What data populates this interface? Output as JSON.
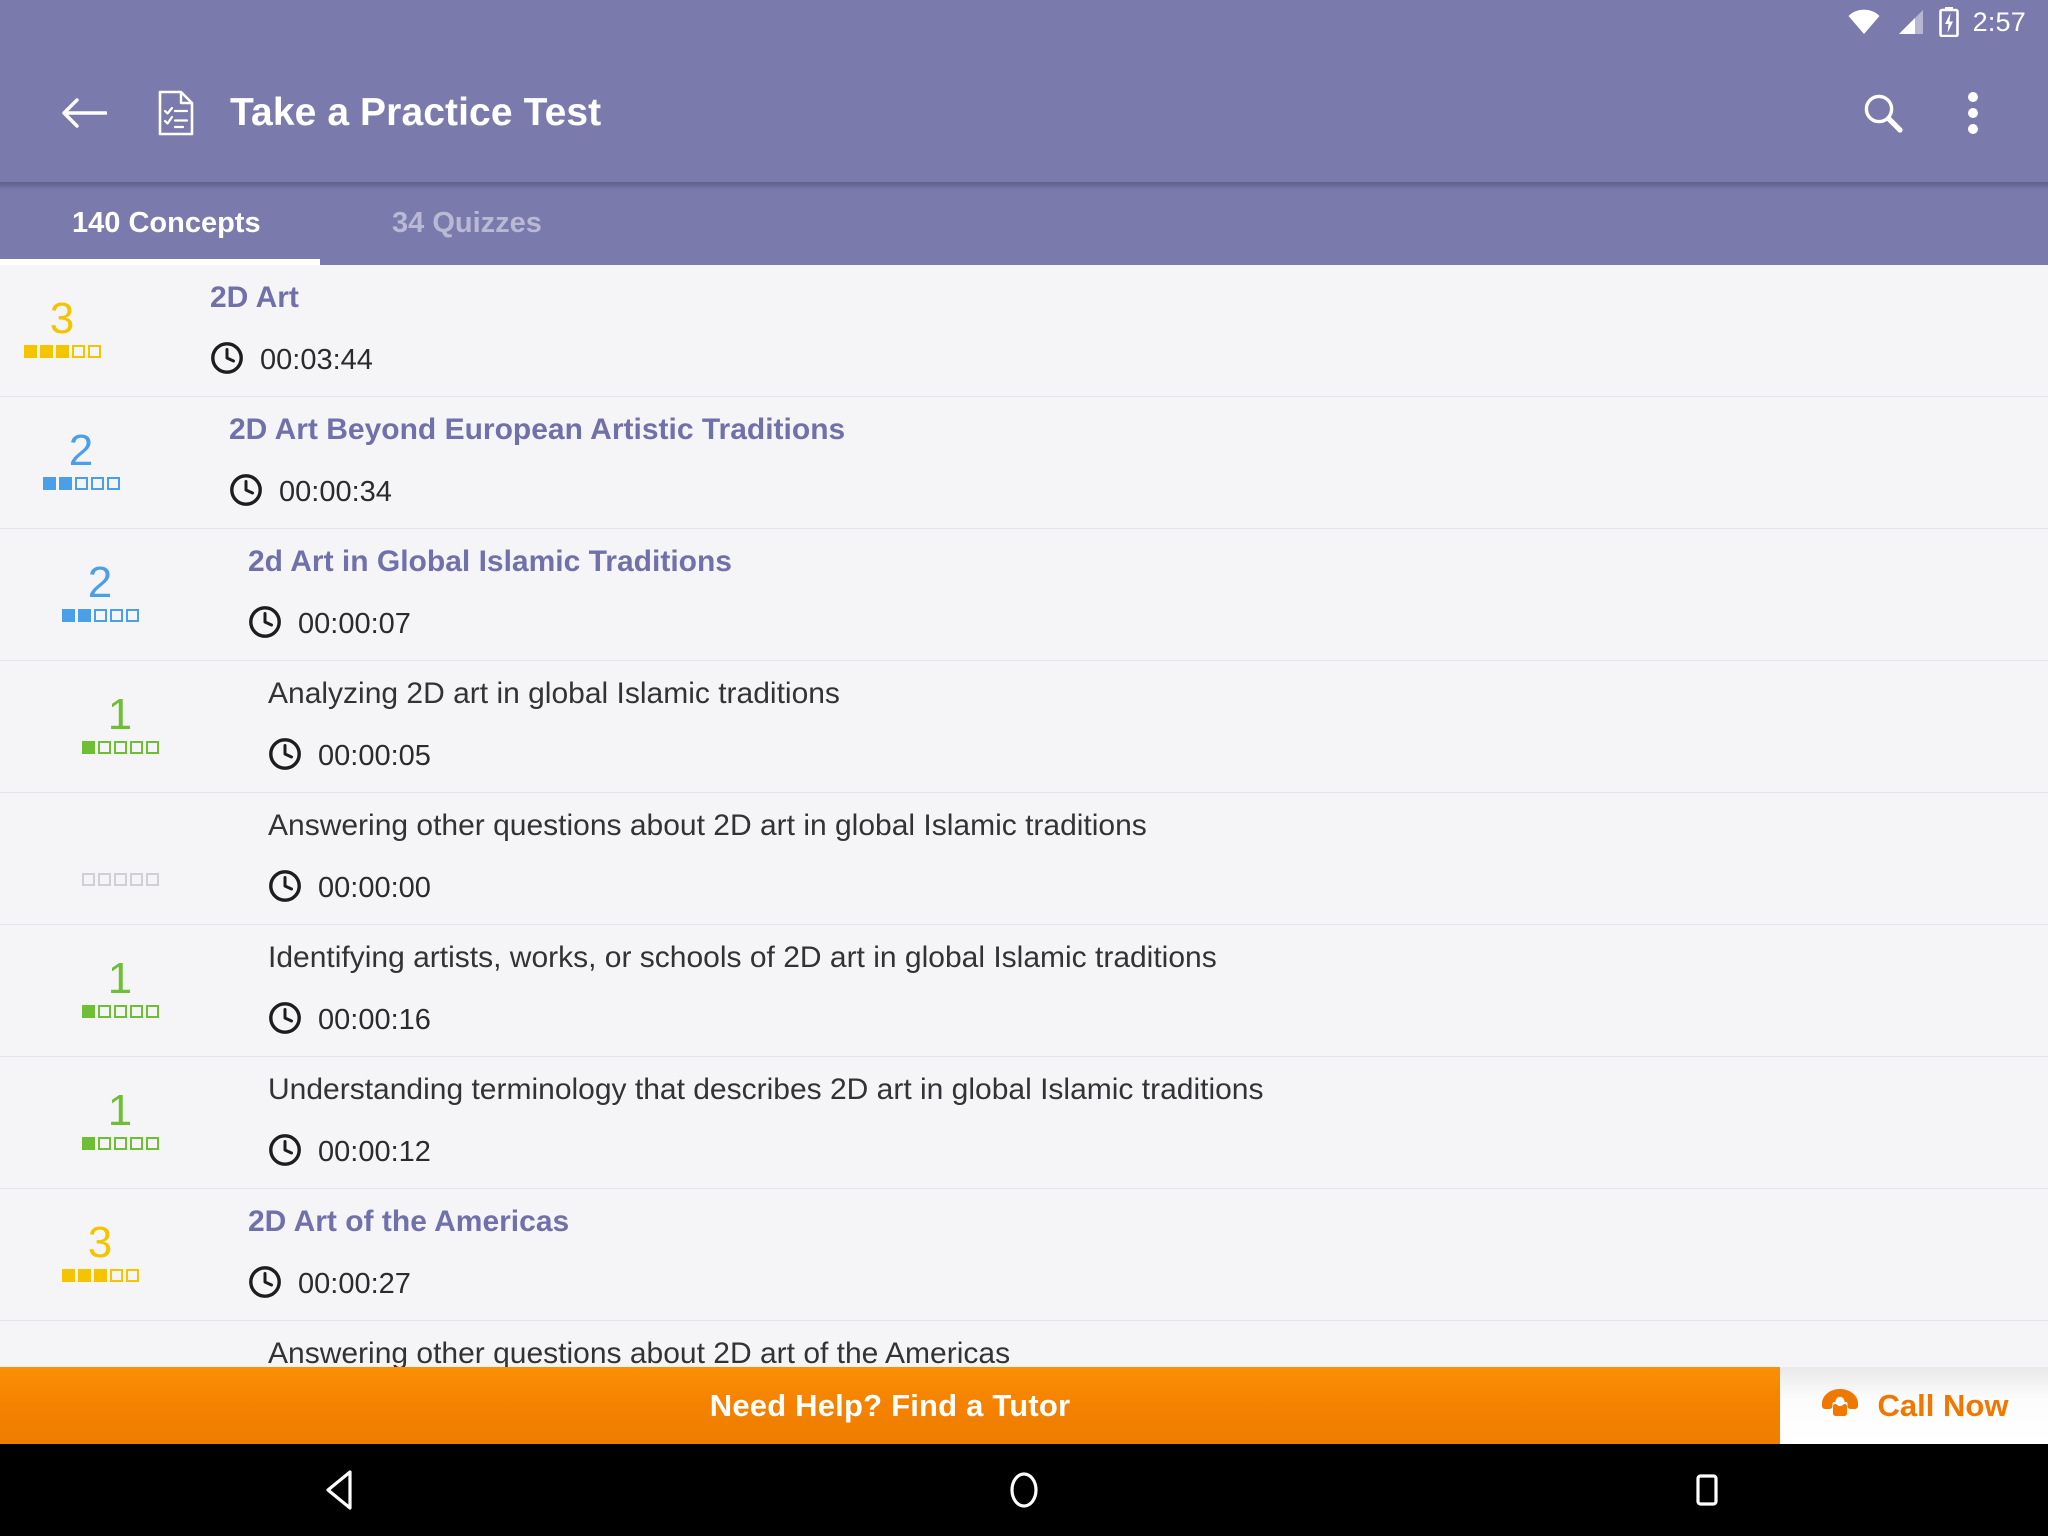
{
  "status_bar": {
    "time": "2:57",
    "icons": [
      "wifi-icon",
      "cell-signal-icon",
      "battery-charging-icon"
    ]
  },
  "app_bar": {
    "back_icon": "back-arrow-icon",
    "doc_icon": "practice-test-document-icon",
    "title": "Take a Practice Test",
    "search_icon": "search-icon",
    "overflow_icon": "overflow-menu-icon"
  },
  "tabs": [
    {
      "label": "140 Concepts",
      "active": true
    },
    {
      "label": "34 Quizzes",
      "active": false
    }
  ],
  "colors": {
    "app_bar": "#7a7aad",
    "concept_title": "#7070aa",
    "rating_gold": "#f5c400",
    "rating_blue": "#4a9fe8",
    "rating_green": "#6fbf36",
    "rating_empty": "#cfcfd6",
    "banner_orange": "#f58300",
    "call_now_text": "#f07800"
  },
  "list": {
    "clock_icon": "clock-icon",
    "rows": [
      {
        "title": "2D Art",
        "kind": "concept",
        "indent": 105,
        "rating": 3,
        "rating_color": "#f5c400",
        "filled": 3,
        "total": 5,
        "time": "00:03:44"
      },
      {
        "title": "2D Art Beyond European Artistic Traditions",
        "kind": "concept",
        "indent": 124,
        "rating": 2,
        "rating_color": "#4a9fe8",
        "filled": 2,
        "total": 5,
        "time": "00:00:34"
      },
      {
        "title": "2d Art in Global Islamic Traditions",
        "kind": "concept",
        "indent": 143,
        "rating": 2,
        "rating_color": "#4a9fe8",
        "filled": 2,
        "total": 5,
        "time": "00:00:07"
      },
      {
        "title": "Analyzing 2D art in global Islamic traditions",
        "kind": "leaf",
        "indent": 163,
        "rating": 1,
        "rating_color": "#6fbf36",
        "filled": 1,
        "total": 5,
        "time": "00:00:05"
      },
      {
        "title": "Answering other questions about 2D art in global Islamic traditions",
        "kind": "leaf",
        "indent": 163,
        "rating": null,
        "rating_color": "#cfcfd6",
        "filled": 0,
        "total": 5,
        "time": "00:00:00"
      },
      {
        "title": "Identifying artists, works, or schools of 2D art in global Islamic traditions",
        "kind": "leaf",
        "indent": 163,
        "rating": 1,
        "rating_color": "#6fbf36",
        "filled": 1,
        "total": 5,
        "time": "00:00:16"
      },
      {
        "title": "Understanding terminology that describes 2D art in global Islamic traditions",
        "kind": "leaf",
        "indent": 163,
        "rating": 1,
        "rating_color": "#6fbf36",
        "filled": 1,
        "total": 5,
        "time": "00:00:12"
      },
      {
        "title": "2D Art of the Americas",
        "kind": "concept",
        "indent": 143,
        "rating": 3,
        "rating_color": "#f5c400",
        "filled": 3,
        "total": 5,
        "time": "00:00:27"
      },
      {
        "title": "Answering other questions about 2D art of the Americas",
        "kind": "leaf",
        "indent": 163,
        "rating": null,
        "rating_color": "#cfcfd6",
        "filled": 0,
        "total": 5,
        "time": ""
      }
    ]
  },
  "banner": {
    "message": "Need Help? Find a Tutor",
    "call_label": "Call Now",
    "phone_icon": "telephone-icon"
  },
  "nav_bar": {
    "back": "nav-back-icon",
    "home": "nav-home-icon",
    "recents": "nav-recents-icon"
  }
}
